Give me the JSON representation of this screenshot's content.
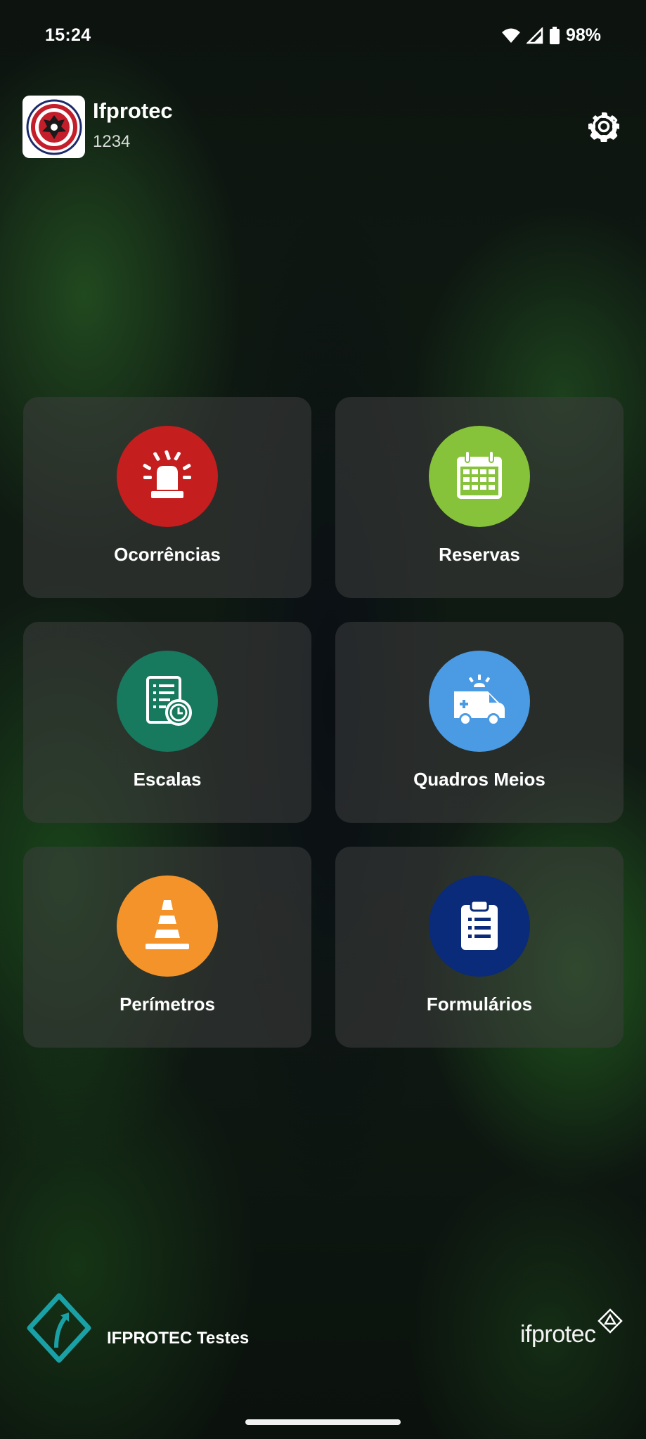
{
  "status_bar": {
    "time": "15:24",
    "battery": "98%",
    "icons": [
      "wifi-icon",
      "signal-icon",
      "battery-icon"
    ]
  },
  "header": {
    "app_name": "Ifprotec",
    "code": "1234",
    "logo_icon": "unit-crest-logo",
    "settings_icon": "gear-icon"
  },
  "menu": {
    "items": [
      {
        "label": "Ocorrências",
        "icon": "siren-icon",
        "color": "#C41E1E"
      },
      {
        "label": "Reservas",
        "icon": "calendar-icon",
        "color": "#86C33A"
      },
      {
        "label": "Escalas",
        "icon": "schedule-icon",
        "color": "#17795E"
      },
      {
        "label": "Quadros Meios",
        "icon": "ambulance-icon",
        "color": "#4A9BE3"
      },
      {
        "label": "Perímetros",
        "icon": "traffic-cone-icon",
        "color": "#F4932A"
      },
      {
        "label": "Formulários",
        "icon": "clipboard-icon",
        "color": "#0A2A7A"
      }
    ]
  },
  "footer": {
    "title": "IFPROTEC Testes",
    "brand": "ifprotec",
    "logo_icon": "ifprotec-arrow-logo",
    "brand_icon": "ifprotec-diamond-icon"
  }
}
